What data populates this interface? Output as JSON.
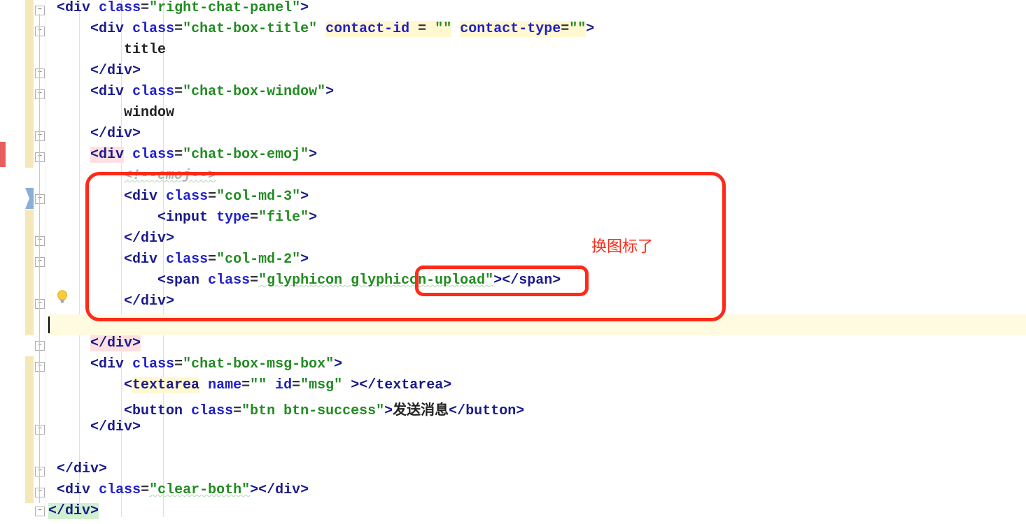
{
  "lines": {
    "l0": {
      "indent": " ",
      "pre": "<",
      "tag": "div",
      "attr1": "class",
      "eq": "=",
      "val1": "\"right-chat-panel\"",
      "post": ">"
    },
    "l1": {
      "indent": "     ",
      "pre": "<",
      "tag": "div",
      "attr1": "class",
      "eq": "=",
      "val1": "\"chat-box-title\"",
      "sp": " ",
      "attr2": "contact-id",
      "eq2": " = ",
      "val2": "\"\"",
      "sp2": " ",
      "attr3": "contact-type",
      "eq3": "=",
      "val3": "\"\"",
      "post": ">"
    },
    "l2": {
      "indent": "         ",
      "text": "title"
    },
    "l3": {
      "indent": "     ",
      "pre": "</",
      "tag": "div",
      "post": ">"
    },
    "l4": {
      "indent": "     ",
      "pre": "<",
      "tag": "div",
      "attr1": "class",
      "eq": "=",
      "val1": "\"chat-box-window\"",
      "post": ">"
    },
    "l5": {
      "indent": "         ",
      "text": "window"
    },
    "l6": {
      "indent": "     ",
      "pre": "</",
      "tag": "div",
      "post": ">"
    },
    "l7": {
      "indent": "     ",
      "pre": "<",
      "tag": "div",
      "attr1": "class",
      "eq": "=",
      "val1": "\"chat-box-emoj\"",
      "post": ">"
    },
    "l8": {
      "indent": "         ",
      "comment": "<!--emoj-->"
    },
    "l9": {
      "indent": "         ",
      "pre": "<",
      "tag": "div",
      "attr1": "class",
      "eq": "=",
      "val1": "\"col-md-3\"",
      "post": ">"
    },
    "l10": {
      "indent": "             ",
      "pre": "<",
      "tag": "input",
      "attr1": "type",
      "eq": "=",
      "val1": "\"file\"",
      "post": ">"
    },
    "l11": {
      "indent": "         ",
      "pre": "</",
      "tag": "div",
      "post": ">"
    },
    "l12": {
      "indent": "         ",
      "pre": "<",
      "tag": "div",
      "attr1": "class",
      "eq": "=",
      "val1": "\"col-md-2\"",
      "post": ">"
    },
    "l13": {
      "indent": "             ",
      "pre": "<",
      "tag": "span",
      "attr1": "class",
      "eq": "=",
      "val1": "\"glyphicon ",
      "val1b": "glyphicon-upload\"",
      "post": "></",
      "tag2": "span",
      "post2": ">"
    },
    "l14": {
      "indent": "         ",
      "pre": "</",
      "tag": "div",
      "post": ">"
    },
    "l15": {
      "indent": ""
    },
    "l16": {
      "indent": "     ",
      "pre": "</",
      "tag": "div",
      "post": ">"
    },
    "l17": {
      "indent": "     ",
      "pre": "<",
      "tag": "div",
      "attr1": "class",
      "eq": "=",
      "val1": "\"chat-box-msg-box\"",
      "post": ">"
    },
    "l18": {
      "indent": "         ",
      "pre": "<",
      "tag": "textarea",
      "attr1": "name",
      "eq": "=",
      "val1": "\"\"",
      "sp": " ",
      "attr2": "id",
      "eq2": "=",
      "val2": "\"msg\"",
      "post": " ></",
      "tag2": "textarea",
      "post2": ">"
    },
    "l19": {
      "indent": "         ",
      "pre": "<",
      "tag": "button",
      "attr1": "class",
      "eq": "=",
      "val1": "\"btn btn-success\"",
      "post": ">",
      "text": "发送消息",
      "close_pre": "</",
      "close_tag": "button",
      "close_post": ">"
    },
    "l20": {
      "indent": "     ",
      "pre": "</",
      "tag": "div",
      "post": ">"
    },
    "l21": {
      "indent": ""
    },
    "l22": {
      "indent": " ",
      "pre": "</",
      "tag": "div",
      "post": ">"
    },
    "l23": {
      "indent": " ",
      "pre": "<",
      "tag": "div",
      "attr1": "class",
      "eq": "=",
      "val1": "\"clear-both\"",
      "post": "></",
      "tag2": "div",
      "post2": ">"
    },
    "l24": {
      "pre": "</",
      "tag": "div",
      "post": ">"
    }
  },
  "annotation": {
    "label": "换图标了"
  }
}
